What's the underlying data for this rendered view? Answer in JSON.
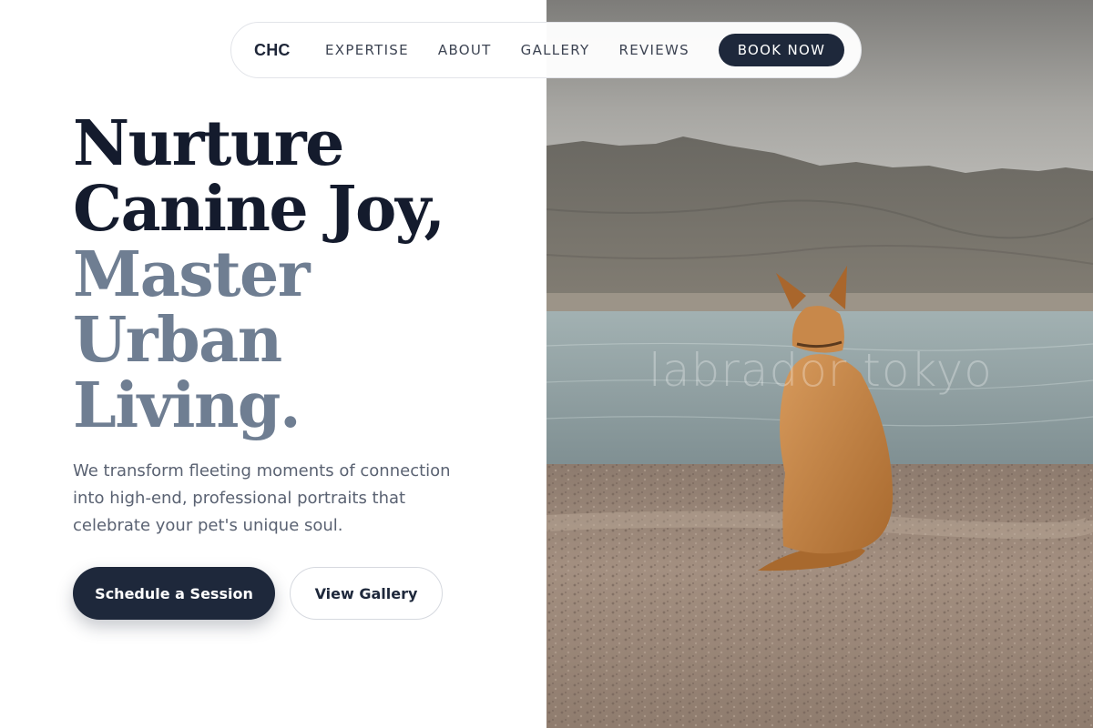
{
  "nav": {
    "logo": "CHC",
    "links": [
      "EXPERTISE",
      "ABOUT",
      "GALLERY",
      "REVIEWS"
    ],
    "cta": "BOOK NOW"
  },
  "hero": {
    "headline_dark": [
      "Nurture",
      "Canine Joy,"
    ],
    "headline_muted": [
      "Master",
      "Urban",
      "Living."
    ],
    "subtext": "We transform fleeting moments of connection into high-end, professional portraits that celebrate your pet's unique soul.",
    "primary_button": "Schedule a Session",
    "secondary_button": "View Gallery"
  },
  "image": {
    "watermark": "labrador tokyo"
  },
  "colors": {
    "navy": "#1e283b",
    "heading_dark": "#141b2d",
    "heading_muted": "#6f7e92",
    "body_text": "#5a6272"
  }
}
